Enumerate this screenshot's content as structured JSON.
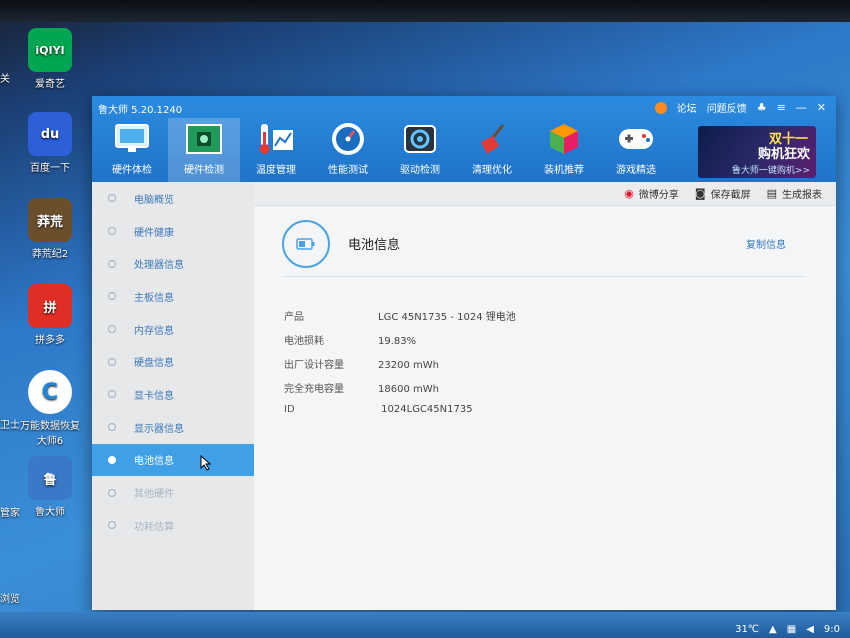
{
  "desktop": {
    "icons": [
      {
        "label": "爱奇艺",
        "glyph": "iQIYI",
        "color": "#00a651"
      },
      {
        "label": "百度一下",
        "glyph": "du",
        "color": "#2d5fd8"
      },
      {
        "label": "莽荒纪2",
        "glyph": "莽荒",
        "color": "#6b4f2a"
      },
      {
        "label": "拼多多",
        "glyph": "拼",
        "color": "#e02e24"
      },
      {
        "label": "万能数据恢复大师6",
        "glyph": "C",
        "color": "#1d86d6"
      },
      {
        "label": "鲁大师",
        "glyph": "鲁",
        "color": "#3a79c8"
      }
    ],
    "edge_labels": [
      "关",
      "卫士",
      "管家",
      "浏览"
    ]
  },
  "app": {
    "title": "鲁大师 5.20.1240",
    "title_links": [
      "论坛",
      "问题反馈"
    ],
    "toolbar": [
      {
        "label": "硬件体检",
        "icon": "monitor-icon"
      },
      {
        "label": "硬件检测",
        "icon": "circuit-board-icon",
        "active": true
      },
      {
        "label": "温度管理",
        "icon": "thermometer-icon"
      },
      {
        "label": "性能测试",
        "icon": "speedometer-icon"
      },
      {
        "label": "驱动检测",
        "icon": "gear-box-icon"
      },
      {
        "label": "清理优化",
        "icon": "broom-icon"
      },
      {
        "label": "装机推荐",
        "icon": "cube-icon"
      },
      {
        "label": "游戏精选",
        "icon": "gamepad-icon"
      }
    ],
    "promo": {
      "line1": "双十一",
      "line2": "购机狂欢",
      "line3": "鲁大师一键购机>>"
    },
    "sidebar": [
      {
        "label": "电脑概览"
      },
      {
        "label": "硬件健康"
      },
      {
        "label": "处理器信息"
      },
      {
        "label": "主板信息"
      },
      {
        "label": "内存信息"
      },
      {
        "label": "硬盘信息"
      },
      {
        "label": "显卡信息"
      },
      {
        "label": "显示器信息"
      },
      {
        "label": "电池信息",
        "active": true
      },
      {
        "label": "其他硬件"
      },
      {
        "label": "功耗估算"
      }
    ],
    "actions": {
      "share": "微博分享",
      "screenshot": "保存截屏",
      "report": "生成报表"
    },
    "section": {
      "title": "电池信息",
      "copy": "复制信息"
    },
    "info": [
      {
        "label": "产品",
        "value": "LGC 45N1735 -  1024 锂电池"
      },
      {
        "label": "电池损耗",
        "value": "19.83%"
      },
      {
        "label": "出厂设计容量",
        "value": "23200 mWh"
      },
      {
        "label": "完全充电容量",
        "value": "18600 mWh"
      },
      {
        "label": "ID",
        "value": " 1024LGC45N1735"
      }
    ]
  },
  "taskbar": {
    "temperature": "31℃",
    "time": "9:0"
  },
  "colors": {
    "header": "#1f73c8",
    "active_nav": "#3fa0e8",
    "accent_link": "#3579c1"
  }
}
